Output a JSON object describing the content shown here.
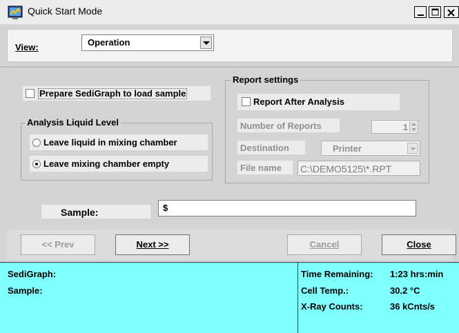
{
  "window": {
    "title": "Quick Start Mode"
  },
  "view": {
    "label": "View:",
    "selected": "Operation"
  },
  "prepare": {
    "label": "Prepare SediGraph to load sample"
  },
  "liquid_level": {
    "legend": "Analysis Liquid Level",
    "options": [
      {
        "label": "Leave liquid in mixing chamber",
        "selected": false
      },
      {
        "label": "Leave mixing chamber empty",
        "selected": true
      }
    ]
  },
  "report": {
    "legend": "Report settings",
    "after_analysis_label": "Report After Analysis",
    "num_reports_label": "Number of Reports",
    "num_reports_value": "1",
    "destination_label": "Destination",
    "destination_value": "Printer",
    "file_name_label": "File name",
    "file_name_value": "C:\\DEMO5125\\*.RPT"
  },
  "sample": {
    "label": "Sample:",
    "value": "$"
  },
  "buttons": {
    "prev": "<< Prev",
    "next": "Next >>",
    "cancel": "Cancel",
    "close": "Close"
  },
  "status": {
    "sedigraph_label": "SediGraph:",
    "sample_label": "Sample:",
    "time_remaining_label": "Time Remaining:",
    "time_remaining_value": "1:23 hrs:min",
    "cell_temp_label": "Cell Temp.:",
    "cell_temp_value": "30.2 °C",
    "xray_label": "X-Ray Counts:",
    "xray_value": "36 kCnts/s"
  },
  "colors": {
    "status_bg": "#80ffff",
    "window_bg": "#d4d4d4"
  }
}
